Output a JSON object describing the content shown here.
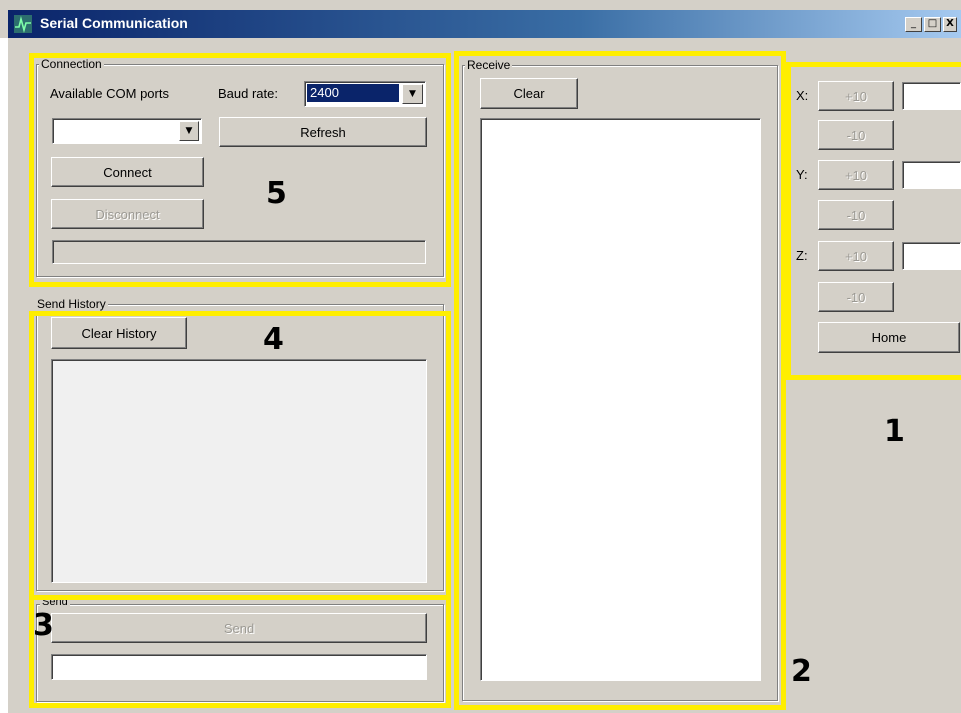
{
  "window": {
    "title": "Serial Communication",
    "minimize": "_",
    "maximize": "□",
    "close": "X"
  },
  "connection": {
    "legend": "Connection",
    "ports_label": "Available COM ports",
    "ports_value": "",
    "baud_label": "Baud rate:",
    "baud_value": "2400",
    "refresh_label": "Refresh",
    "connect_label": "Connect",
    "disconnect_label": "Disconnect",
    "status_text": ""
  },
  "history": {
    "legend": "Send History",
    "clear_label": "Clear History"
  },
  "send": {
    "legend": "Send",
    "send_label": "Send",
    "input_value": ""
  },
  "receive": {
    "legend": "Receive",
    "clear_label": "Clear"
  },
  "axes": {
    "x_label": "X:",
    "y_label": "Y:",
    "z_label": "Z:",
    "plus_label": "+10",
    "minus_label": "-10",
    "home_label": "Home"
  },
  "annotations": {
    "n1": "1",
    "n2": "2",
    "n3": "3",
    "n4": "4",
    "n5": "5"
  },
  "colors": {
    "highlight": "#ffee00",
    "titlebar_start": "#0a246a",
    "selection": "#0a246a",
    "face": "#d4d0c8"
  }
}
